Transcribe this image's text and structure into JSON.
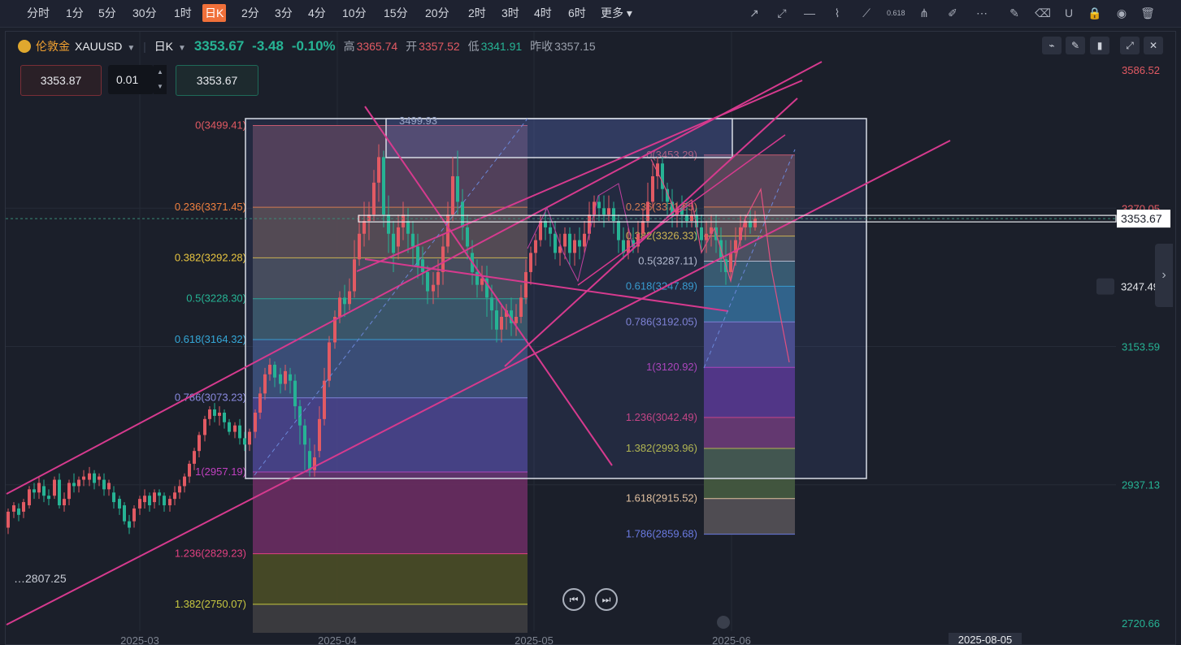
{
  "timeframes": [
    {
      "label": "分时",
      "active": false
    },
    {
      "label": "1分",
      "active": false
    },
    {
      "label": "5分",
      "active": false
    },
    {
      "label": "30分",
      "active": false
    },
    {
      "label": "1时",
      "active": false
    },
    {
      "label": "日K",
      "active": true
    },
    {
      "label": "2分",
      "active": false
    },
    {
      "label": "3分",
      "active": false
    },
    {
      "label": "4分",
      "active": false
    },
    {
      "label": "10分",
      "active": false
    },
    {
      "label": "15分",
      "active": false
    },
    {
      "label": "20分",
      "active": false
    },
    {
      "label": "2时",
      "active": false
    },
    {
      "label": "3时",
      "active": false
    },
    {
      "label": "4时",
      "active": false
    },
    {
      "label": "6时",
      "active": false
    },
    {
      "label": "更多",
      "active": false
    }
  ],
  "tools": [
    "ray-line-icon",
    "extended-line-icon",
    "horizontal-line-icon",
    "polyline-icon",
    "brush-icon",
    "fibonacci-icon",
    "fan-icon",
    "highlighter-icon",
    "more-tools-icon",
    "edit-icon",
    "eraser-icon",
    "magnet-icon",
    "lock-icon",
    "eye-icon",
    "trash-icon"
  ],
  "fib_tool_label": "0.618",
  "symbol": {
    "name": "伦敦金",
    "code": "XAUUSD",
    "period": "日K",
    "last": "3353.67",
    "change": "-3.48",
    "change_pct": "-0.10%",
    "high_label": "高",
    "high": "3365.74",
    "open_label": "开",
    "open": "3357.52",
    "low_label": "低",
    "low": "3341.91",
    "prev_label": "昨收",
    "prev": "3357.15"
  },
  "order_panel": {
    "sell": "3353.87",
    "qty": "0.01",
    "buy": "3353.67"
  },
  "price_axis": {
    "ticks": [
      "3586.52",
      "3370.05",
      "3153.59",
      "2937.13",
      "2720.66"
    ],
    "current": "3353.67",
    "alert": "3247.49"
  },
  "time_axis": {
    "ticks": [
      "2025-03",
      "2025-04",
      "2025-05",
      "2025-06"
    ],
    "cursor": "2025-08-05"
  },
  "fib_left": [
    {
      "label": "0(3499.41)",
      "color": "#e25a63"
    },
    {
      "label": "0.236(3371.45)",
      "color": "#f08040"
    },
    {
      "label": "0.382(3292.28)",
      "color": "#e8c540"
    },
    {
      "label": "0.5(3228.30)",
      "color": "#26b394"
    },
    {
      "label": "0.618(3164.32)",
      "color": "#35a8d8"
    },
    {
      "label": "0.786(3073.23)",
      "color": "#8a8ae0"
    },
    {
      "label": "1(2957.19)",
      "color": "#c040c0"
    },
    {
      "label": "1.236(2829.23)",
      "color": "#e04080"
    },
    {
      "label": "1.382(2750.07)",
      "color": "#c8c840"
    }
  ],
  "fib_right": [
    {
      "label": "0(3453.29)",
      "color": "#e25a63"
    },
    {
      "label": "0.236(3371.85)",
      "color": "#f08040"
    },
    {
      "label": "0.382(3326.33)",
      "color": "#e8c540"
    },
    {
      "label": "0.5(3287.11)",
      "color": "#c8ccd6"
    },
    {
      "label": "0.618(3247.89)",
      "color": "#35a8d8"
    },
    {
      "label": "0.786(3192.05)",
      "color": "#8a8ae0"
    },
    {
      "label": "1(3120.92)",
      "color": "#c040c0"
    },
    {
      "label": "1.236(3042.49)",
      "color": "#e04080"
    },
    {
      "label": "1.382(2993.96)",
      "color": "#c8c840"
    },
    {
      "label": "1.618(2915.52)",
      "color": "#e0c0a0"
    },
    {
      "label": "1.786(2859.68)",
      "color": "#6a7ae0"
    }
  ],
  "rect_label": "3499.93",
  "low_label": "2807.25",
  "colors": {
    "up": "#26b394",
    "down": "#e25a63",
    "accent": "#f0703a",
    "trend": "#d63a8e"
  }
}
